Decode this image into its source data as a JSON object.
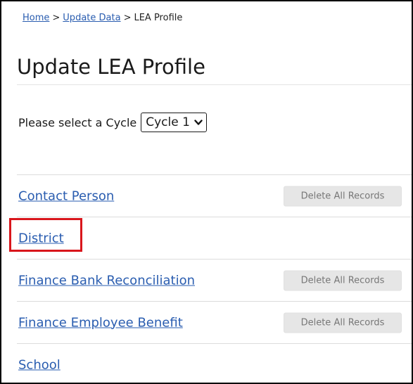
{
  "breadcrumb": {
    "home": "Home",
    "separator": ">",
    "update_data": "Update Data",
    "current": "LEA Profile"
  },
  "page": {
    "title": "Update LEA Profile"
  },
  "cycle": {
    "label": "Please select a Cycle",
    "selected": "Cycle 1"
  },
  "items": [
    {
      "label": "Contact Person",
      "delete_label": "Delete All Records"
    },
    {
      "label": "District",
      "delete_label": ""
    },
    {
      "label": "Finance Bank Reconciliation",
      "delete_label": "Delete All Records"
    },
    {
      "label": "Finance Employee Benefit",
      "delete_label": "Delete All Records"
    },
    {
      "label": "School",
      "delete_label": ""
    }
  ],
  "colors": {
    "link": "#2a5db0",
    "highlight": "#d9161c",
    "button_bg": "#e6e6e6",
    "button_text": "#777777"
  },
  "icons": {
    "cycle_dropdown": "chevron-down-icon"
  }
}
